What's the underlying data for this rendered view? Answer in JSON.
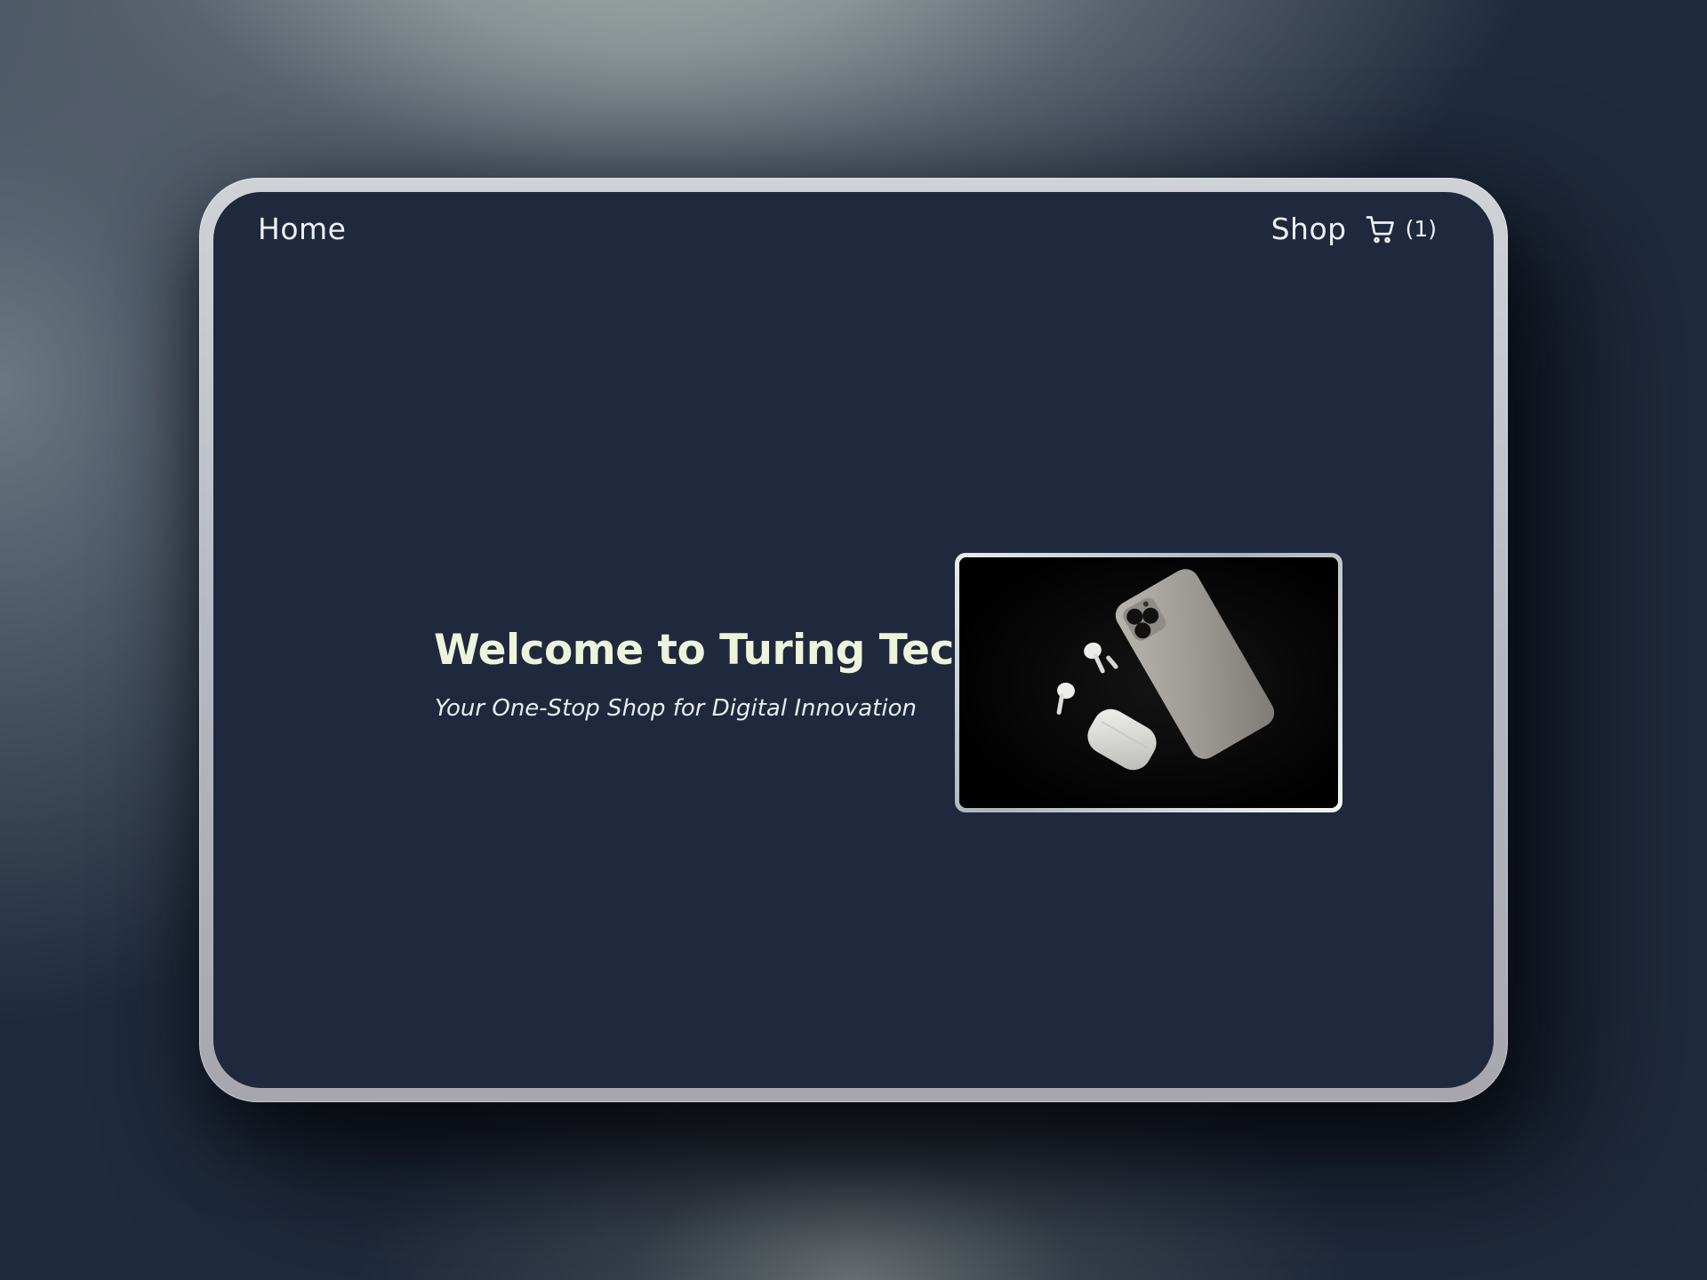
{
  "nav": {
    "home_label": "Home",
    "shop_label": "Shop",
    "cart_icon": "shopping-cart-icon",
    "cart_count": "(1)"
  },
  "hero": {
    "title": "Welcome to Turing Tech",
    "subtitle": "Your One-Stop Shop for Digital Innovation",
    "image_description_icon": "product-photo"
  },
  "colors": {
    "screen_background": "#1f283c",
    "title_color": "#edf4dc",
    "text_color": "#eef0f4",
    "device_frame": "#c3c7ce"
  }
}
